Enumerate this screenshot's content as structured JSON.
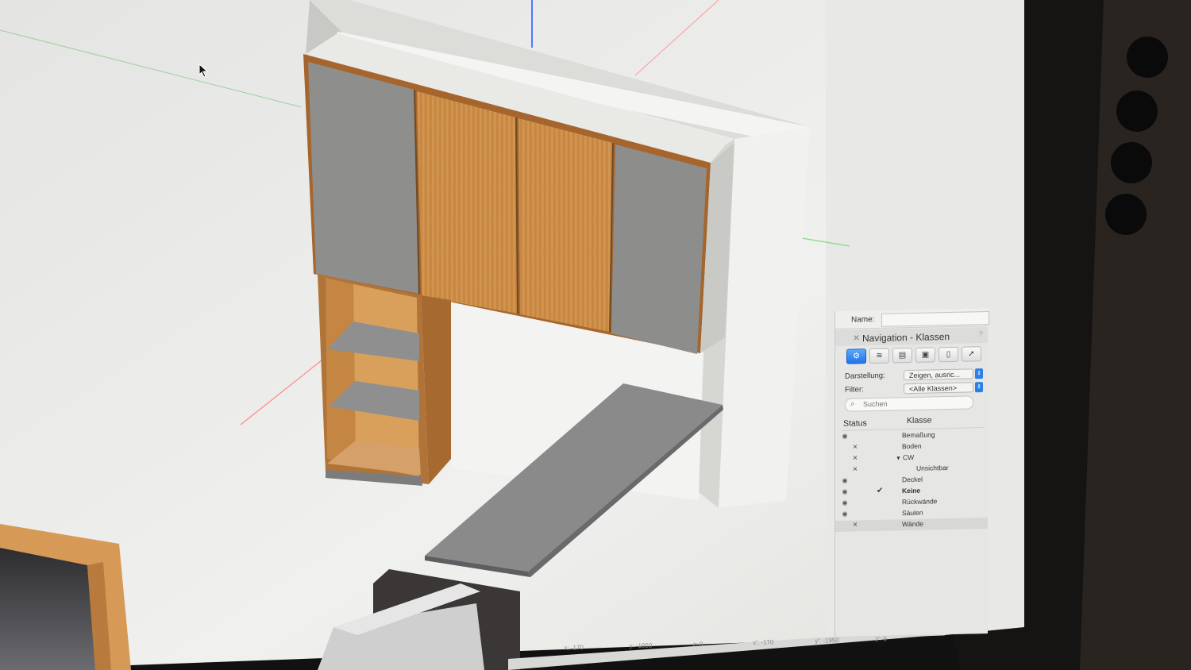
{
  "panel": {
    "name_label": "Name:",
    "name_value": "",
    "title": "Navigation - Klassen",
    "help": "?",
    "toolbar": [
      "classes-icon",
      "layers-icon",
      "sheet-layers-icon",
      "viewports-icon",
      "references-icon",
      "symbols-icon"
    ],
    "darstellung_label": "Darstellung:",
    "darstellung_value": "Zeigen, ausric...",
    "filter_label": "Filter:",
    "filter_value": "<Alle Klassen>",
    "search_placeholder": "Suchen",
    "col_status": "Status",
    "col_klasse": "Klasse",
    "classes": [
      {
        "name": "Bemaßung",
        "status": "eye",
        "indent": 0
      },
      {
        "name": "Boden",
        "status": "x",
        "indent": 0
      },
      {
        "name": "CW",
        "status": "x",
        "indent": 0,
        "expanded": true
      },
      {
        "name": "Unsichtbar",
        "status": "x",
        "indent": 1
      },
      {
        "name": "Deckel",
        "status": "eye",
        "indent": 0
      },
      {
        "name": "Keine",
        "status": "eye",
        "indent": 0,
        "active": true
      },
      {
        "name": "Rückwände",
        "status": "eye",
        "indent": 0
      },
      {
        "name": "Säulen",
        "status": "eye",
        "indent": 0
      },
      {
        "name": "Wände",
        "status": "x",
        "indent": 0,
        "selected": true
      }
    ]
  },
  "statusbar": {
    "x": "x: -170",
    "y": "y: -1950",
    "z": "z: 0",
    "x2": "x': -170",
    "y2": "y': -1950",
    "z2": "z': 0"
  },
  "colors": {
    "oak": "#c98a45",
    "grey_panel": "#8f8f8f",
    "wall": "#ececea",
    "accent": "#1f74e8"
  }
}
